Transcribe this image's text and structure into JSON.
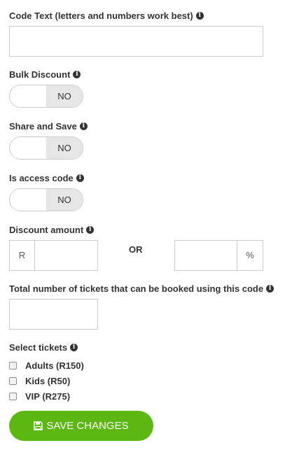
{
  "code_text": {
    "label": "Code Text (letters and numbers work best)",
    "value": ""
  },
  "bulk_discount": {
    "label": "Bulk Discount",
    "state": "NO"
  },
  "share_and_save": {
    "label": "Share and Save",
    "state": "NO"
  },
  "access_code": {
    "label": "Is access code",
    "state": "NO"
  },
  "discount_amount": {
    "label": "Discount amount",
    "currency_prefix": "R",
    "currency_value": "",
    "or_label": "OR",
    "percent_value": "",
    "percent_suffix": "%"
  },
  "total_tickets": {
    "label": "Total number of tickets that can be booked using this code",
    "value": ""
  },
  "select_tickets": {
    "label": "Select tickets",
    "items": [
      {
        "label": "Adults (R150)",
        "checked": false
      },
      {
        "label": "Kids (R50)",
        "checked": false
      },
      {
        "label": "VIP (R275)",
        "checked": false
      }
    ]
  },
  "save_button": {
    "label": "SAVE CHANGES",
    "icon": "floppy-disk-icon",
    "color": "#5cb811"
  },
  "info_icon": "info-circle-icon"
}
